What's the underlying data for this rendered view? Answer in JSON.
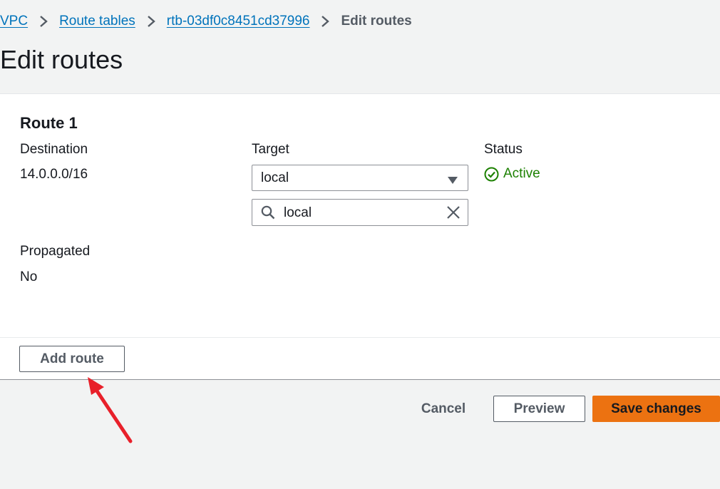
{
  "breadcrumb": {
    "items": [
      {
        "label": "VPC"
      },
      {
        "label": "Route tables"
      },
      {
        "label": "rtb-03df0c8451cd37996"
      }
    ],
    "current": "Edit routes"
  },
  "page": {
    "title": "Edit routes"
  },
  "route": {
    "title": "Route 1",
    "destination_label": "Destination",
    "destination_value": "14.0.0.0/16",
    "target_label": "Target",
    "target_value": "local",
    "target_search_value": "local",
    "status_label": "Status",
    "status_value": "Active",
    "propagated_label": "Propagated",
    "propagated_value": "No"
  },
  "actions": {
    "add_route": "Add route",
    "cancel": "Cancel",
    "preview": "Preview",
    "save": "Save changes"
  },
  "colors": {
    "link": "#0073bb",
    "status_active": "#1d8102",
    "primary_button": "#ec7211",
    "annotation_arrow": "#e8202a"
  },
  "icons": [
    "chevron-right-icon",
    "caret-down-icon",
    "search-icon",
    "clear-icon",
    "status-success-icon",
    "annotation-arrow-icon"
  ]
}
